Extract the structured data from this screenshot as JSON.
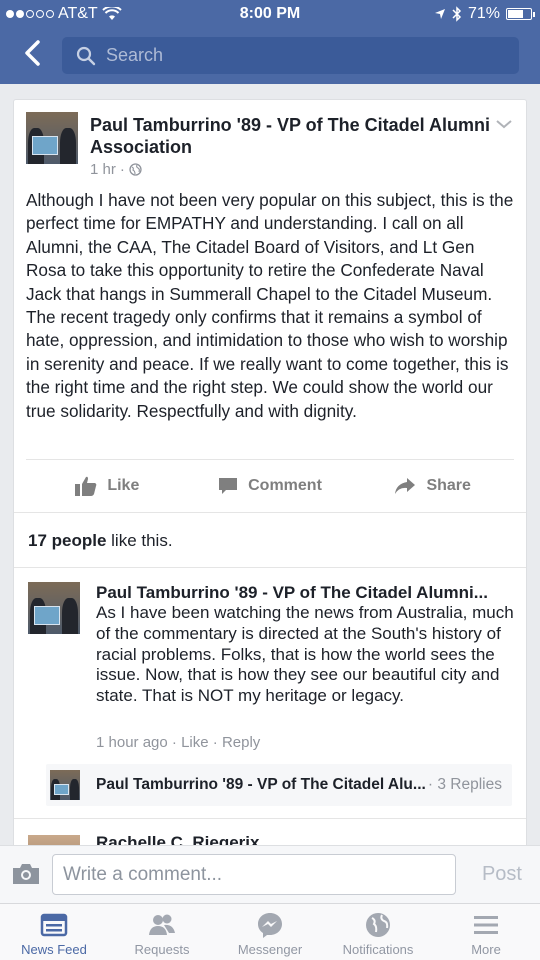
{
  "status_bar": {
    "carrier": "AT&T",
    "time": "8:00 PM",
    "battery": "71%",
    "battery_level": 0.71
  },
  "nav": {
    "search_placeholder": "Search"
  },
  "post": {
    "author": "Paul Tamburrino '89 - VP of The Citadel Alumni Association",
    "time": "1 hr",
    "separator": "·",
    "text": "Although I have not been very popular on this subject, this is the perfect time for EMPATHY and understanding. I call on all Alumni, the CAA, The Citadel Board of Visitors, and Lt Gen Rosa to take this opportunity to retire the Confederate Naval Jack that hangs in Summerall Chapel to the Citadel Museum. The recent tragedy only confirms that it remains a symbol of hate, oppression, and intimidation to those who wish to worship in serenity and peace. If we really want to come together, this is the right time and the right step. We could show the world our true solidarity. Respectfully and with dignity.",
    "actions": {
      "like": "Like",
      "comment": "Comment",
      "share": "Share"
    },
    "likes_count": "17 people",
    "likes_suffix": " like this."
  },
  "comments": [
    {
      "author": "Paul Tamburrino '89 - VP of The Citadel Alumni...",
      "text": "As I have been watching the news from Australia, much of the commentary is directed at the South's history of racial problems. Folks, that is how the world sees the issue. Now, that is how they see our beautiful city and state. That is NOT my heritage or legacy.",
      "time": "1 hour ago",
      "like": "Like",
      "reply": "Reply",
      "sep": "·",
      "reply_preview": {
        "author": "Paul Tamburrino '89 - VP of The Citadel Alu...",
        "count": "3 Replies",
        "sep": "·"
      }
    },
    {
      "author": "Rachelle C. Riegerix"
    }
  ],
  "composer": {
    "placeholder": "Write a comment...",
    "post_label": "Post"
  },
  "tabs": [
    {
      "label": "News Feed",
      "icon": "news-feed-icon",
      "active": true
    },
    {
      "label": "Requests",
      "icon": "requests-icon",
      "active": false
    },
    {
      "label": "Messenger",
      "icon": "messenger-icon",
      "active": false
    },
    {
      "label": "Notifications",
      "icon": "globe-icon",
      "active": false
    },
    {
      "label": "More",
      "icon": "menu-icon",
      "active": false
    }
  ],
  "colors": {
    "brand": "#4b69a5",
    "tab_inactive": "#9197a3"
  }
}
